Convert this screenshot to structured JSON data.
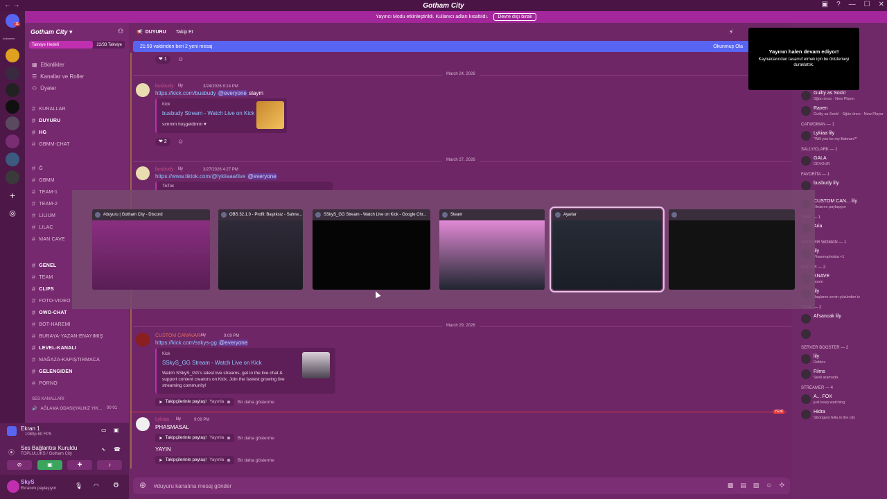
{
  "window": {
    "title": "Gotham City"
  },
  "notice": {
    "text": "Yayıncı Modu etkinleştirildi. Kullanıcı adları kısaltıldı.",
    "button": "Devre dışı bırak"
  },
  "rail": {
    "badge_top": "11",
    "download_label": "İndirmeler",
    "badge_a": "1",
    "badge_b": "16",
    "badge_c": "4"
  },
  "sidebar": {
    "server_name": "Gotham City",
    "boost": {
      "label": "Takviye Hedefi",
      "count": "22/33 Takviye",
      "progress": 0.67
    },
    "top_items": [
      "Etkinlikler",
      "Kanallar ve Roller",
      "Üyeler"
    ],
    "channels_a": [
      {
        "name": "kurallar",
        "bold": false
      },
      {
        "name": "duyuru",
        "bold": true
      },
      {
        "name": "hg",
        "bold": true
      },
      {
        "name": "gbmm-chat",
        "bold": false
      }
    ],
    "channels_b": [
      {
        "name": "ğ"
      },
      {
        "name": "gbmm"
      },
      {
        "name": "team-1"
      },
      {
        "name": "team-2"
      },
      {
        "name": "lilium"
      },
      {
        "name": "lilac"
      },
      {
        "name": "man cave"
      }
    ],
    "channels_c": [
      {
        "name": "genel",
        "bold": true
      },
      {
        "name": "team",
        "bold": false
      },
      {
        "name": "clips",
        "bold": true
      },
      {
        "name": "foto-video",
        "bold": false
      },
      {
        "name": "owo-chat",
        "bold": true
      },
      {
        "name": "bot-haremı",
        "bold": false
      },
      {
        "name": "buraya-yazan-enayimiş",
        "bold": false
      },
      {
        "name": "level-kanalı",
        "bold": true
      },
      {
        "name": "mağaza-kapiştirmaca",
        "bold": false
      },
      {
        "name": "gelengiden",
        "bold": true
      },
      {
        "name": "porno",
        "bold": false
      }
    ],
    "voice_category": "SES KANALLARI",
    "voice_channel": "AĞLAMA ODASI(YALNIZ YIK...",
    "voice_counts": "00  01"
  },
  "voice_panel": {
    "screen": "Ekran 1",
    "screen_sub": "1080p 60 FPS",
    "status": "Ses Bağlantısı Kuruldu",
    "status_sub": "TOPLULUKS / Gotham City"
  },
  "user_panel": {
    "name": "SkyS",
    "status": "Ekranını paylaşıyor"
  },
  "header": {
    "channel": "DUYURU",
    "follow": "Takip Et"
  },
  "newmsg": {
    "text": "21:59 vaktinden beri 2 yeni mesaj",
    "action": "Okunmuş Ola"
  },
  "messages": {
    "date1": "March 24, 2026",
    "date2": "March 27, 2026",
    "date3": "March 29, 2026",
    "m1": {
      "user": "busbudy",
      "tag": "lily",
      "time": "3/24/2026 8:14 PM",
      "link": "https://kick.com/busbudy",
      "mention": "@everyone",
      "text": "slaym",
      "embed_provider": "Kick",
      "embed_title": "busbudy Stream - Watch Live on Kick",
      "embed_desc": "sımmm hoşgeldinnn ♥",
      "reaction_count": "2"
    },
    "m0_reaction": "1",
    "m2": {
      "user": "busbudy",
      "tag": "lily",
      "time": "3/27/2026 4:27 PM",
      "link": "https://www.tiktok.com/@lykiiaaa/live",
      "mention": "@everyone",
      "embed_provider": "TikTok"
    },
    "m3": {
      "user": "CUSTOM CANAVARı",
      "tag": "lily",
      "time": "9:09 PM",
      "link": "https://kick.com/sskys-gg",
      "mention": "@everyone",
      "embed_provider": "Kick",
      "embed_title": "SSkyS_GG Stream - Watch Live on Kick",
      "embed_desc": "Watch SSkyS_GG's latest live streams, get in the live chat & support content creators on Kick. Join the fastest growing live streaming community!",
      "share": "Takipçilerinle paylaş!",
      "share_action": "Yayınla",
      "dismiss": "Bir daha gösterme"
    },
    "new_tag": "YENİ",
    "m4": {
      "user": "Lykiaa",
      "tag": "lily",
      "time": "9:09 PM",
      "text1": "PHASMASAL",
      "text2": "YAYIN",
      "share": "Takipçilerinle paylaş!",
      "share_action": "Yayınla",
      "dismiss": "Bir daha gösterme"
    }
  },
  "alttab": [
    {
      "title": "#duyuru | Gotham City - Discord",
      "theme": "discord"
    },
    {
      "title": "OBS 32.1.0 - Profil: Başlıksız - Sahne...",
      "theme": "obs"
    },
    {
      "title": "SSkyS_GG Stream - Watch Live on Kick - Google Chr...",
      "theme": "black"
    },
    {
      "title": "Steam",
      "theme": "steam"
    },
    {
      "title": "Ayarlar",
      "theme": "settings"
    },
    {
      "title": "",
      "theme": "terminal"
    }
  ],
  "stream_popup": {
    "title": "Yayının halen devam ediyor!",
    "text": "Kaynaklarından tasarruf etmek için bu önizlemeyi duraklattık."
  },
  "members": [
    {
      "cat": "",
      "items": [
        {
          "name": "Guilty as Sock!",
          "sub": "Sğün önce · New Player"
        },
        {
          "name": "Raven",
          "sub": "Guilty as Sock! · Sğün önce · New Player"
        }
      ]
    },
    {
      "cat": "CATWOMAN — 1",
      "items": [
        {
          "name": "Lykiaa  lily",
          "sub": "\"Will you be my Batman?\""
        }
      ]
    },
    {
      "cat": "SALLY/CLARK — 1",
      "items": [
        {
          "name": "GALA",
          "sub": "DEVOUR"
        }
      ]
    },
    {
      "cat": "FAVORİTA — 1",
      "items": [
        {
          "name": "busbudy  lily",
          "sub": ""
        }
      ]
    },
    {
      "cat": "",
      "items": [
        {
          "name": "CUSTOM CAN...  lily",
          "sub": "Ekranını paylaşıyor"
        }
      ]
    },
    {
      "cat": "TEST — 1",
      "items": [
        {
          "name": "Aria",
          "sub": ""
        }
      ]
    },
    {
      "cat": "WONDER WOMAN — 1",
      "items": [
        {
          "name": "lily",
          "sub": "Phasmophobia +1"
        }
      ]
    },
    {
      "cat": "EDITOR — 2",
      "items": [
        {
          "name": "KNAVE",
          "sub": "boom"
        },
        {
          "name": "lily",
          "sub": "Başlanın senin yüzünden iz"
        }
      ]
    },
    {
      "cat": "TEAM — 2",
      "items": [
        {
          "name": "Al'sancak  lily",
          "sub": ""
        },
        {
          "name": "",
          "sub": ""
        }
      ]
    },
    {
      "cat": "SERVER BOOSTER — 2",
      "items": [
        {
          "name": "lily",
          "sub": "Roblox"
        },
        {
          "name": "Films",
          "sub": "Sesli aramada"
        }
      ]
    },
    {
      "cat": "STREAMER — 4",
      "items": [
        {
          "name": "A...  FOX",
          "sub": "just keep watching"
        },
        {
          "name": "Hidra",
          "sub": "Strongest fella in the city"
        }
      ]
    }
  ],
  "composer": {
    "placeholder": "#duyuru kanalına mesaj gönder"
  },
  "colors": {
    "accent": "#c02fb0",
    "bg": "#6e2666",
    "blurple": "#5865f2",
    "link": "#8ec5ff"
  }
}
